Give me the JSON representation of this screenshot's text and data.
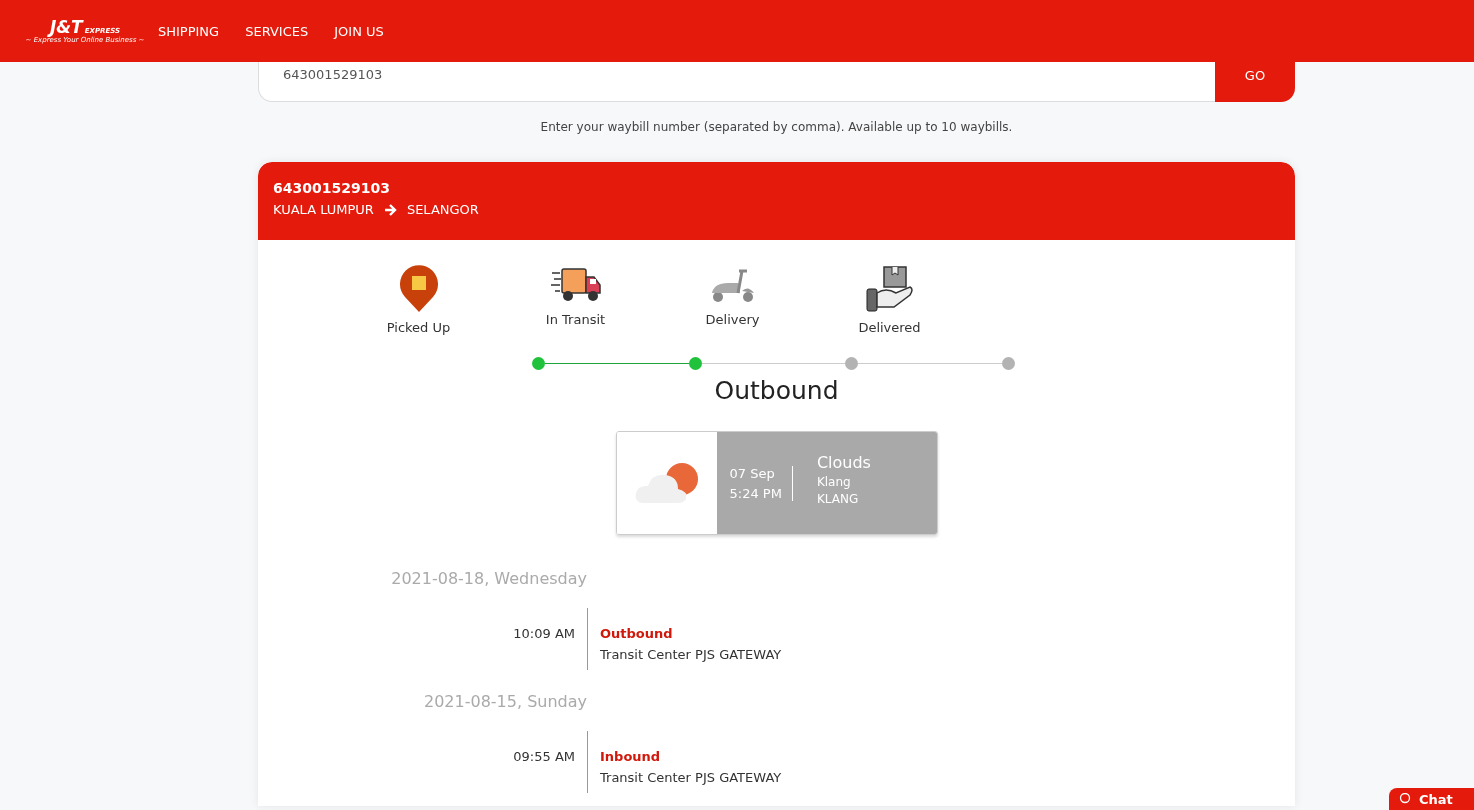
{
  "header": {
    "logo": {
      "mark": "J&T",
      "word": "EXPRESS",
      "tagline": "~ Express Your Online Business ~"
    },
    "nav": [
      {
        "label": "SHIPPING"
      },
      {
        "label": "SERVICES"
      },
      {
        "label": "JOIN US"
      }
    ]
  },
  "search": {
    "value": "643001529103",
    "button": "GO",
    "hint": "Enter your waybill number (separated by comma). Available up to 10 waybills."
  },
  "shipment": {
    "waybill": "643001529103",
    "origin": "KUALA LUMPUR",
    "destination": "SELANGOR",
    "steps": [
      {
        "kind": "pin",
        "label": "Picked Up",
        "done": true
      },
      {
        "kind": "truck",
        "label": "In Transit",
        "done": true
      },
      {
        "kind": "scooter",
        "label": "Delivery",
        "done": false
      },
      {
        "kind": "hand",
        "label": "Delivered",
        "done": false
      }
    ],
    "current_status": "Outbound",
    "weather": {
      "date": "07 Sep",
      "time": "5:24 PM",
      "condition": "Clouds",
      "city": "Klang",
      "area": "KLANG"
    },
    "history": [
      {
        "date": "2021-08-18, Wednesday",
        "events": [
          {
            "time": "10:09 AM",
            "status": "Outbound",
            "detail": "Transit Center PJS GATEWAY"
          }
        ]
      },
      {
        "date": "2021-08-15, Sunday",
        "events": [
          {
            "time": "09:55 AM",
            "status": "Inbound",
            "detail": "Transit Center PJS GATEWAY"
          }
        ]
      }
    ]
  },
  "chat": {
    "label": "Chat"
  }
}
